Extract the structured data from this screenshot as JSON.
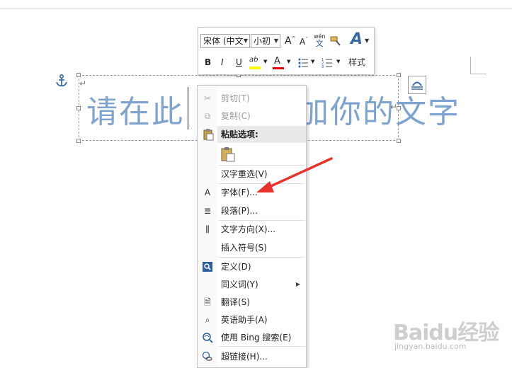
{
  "document": {
    "textbox_text": "请在此添加你的文字",
    "text_before_caret": "请在此",
    "text_after_caret": "加你的文字"
  },
  "mini_toolbar": {
    "font_name": "宋体 (中文",
    "font_size": "小初",
    "grow_font": "A",
    "shrink_font": "A",
    "phonetic_top": "wén",
    "phonetic_bottom": "文",
    "bold": "B",
    "italic": "I",
    "underline": "U",
    "highlight": "ab",
    "font_color": "A",
    "styles_label": "样式"
  },
  "context_menu": {
    "items": [
      {
        "label": "剪切(T)",
        "icon": "scissors-icon",
        "enabled": false
      },
      {
        "label": "复制(C)",
        "icon": "copy-icon",
        "enabled": false
      },
      {
        "label": "粘贴选项:",
        "icon": "paste-icon",
        "enabled": true
      },
      {
        "label": "汉字重选(V)",
        "icon": "",
        "enabled": true
      },
      {
        "label": "字体(F)...",
        "icon": "font-icon",
        "enabled": true
      },
      {
        "label": "段落(P)...",
        "icon": "paragraph-icon",
        "enabled": true
      },
      {
        "label": "文字方向(X)...",
        "icon": "text-direction-icon",
        "enabled": true
      },
      {
        "label": "插入符号(S)",
        "icon": "",
        "enabled": true
      },
      {
        "label": "定义(D)",
        "icon": "define-icon",
        "enabled": true
      },
      {
        "label": "同义词(Y)",
        "icon": "",
        "enabled": true
      },
      {
        "label": "翻译(S)",
        "icon": "translate-icon",
        "enabled": true
      },
      {
        "label": "英语助手(A)",
        "icon": "english-assistant-icon",
        "enabled": true
      },
      {
        "label": "使用 Bing 搜索(E)",
        "icon": "bing-search-icon",
        "enabled": true
      },
      {
        "label": "超链接(H)...",
        "icon": "hyperlink-icon",
        "enabled": true
      }
    ]
  },
  "watermark": {
    "brand": "Baidu经验",
    "url": "jingyan.baidu.com"
  },
  "colors": {
    "text_blue": "#7ea3cf",
    "arrow_red": "#e8322b",
    "highlight_yellow": "#ffff00",
    "font_red": "#e00000"
  }
}
